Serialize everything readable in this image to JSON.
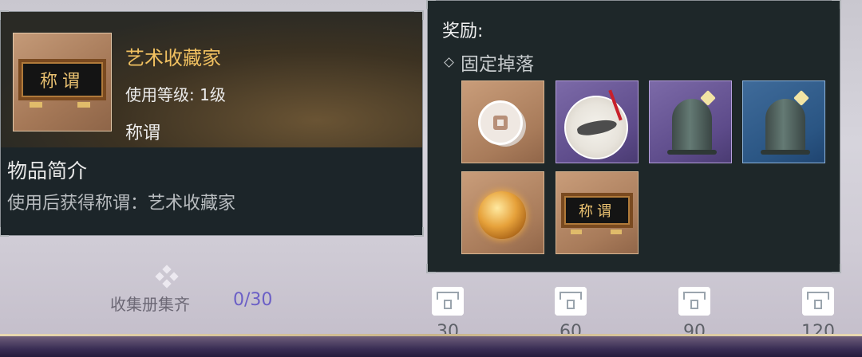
{
  "item": {
    "name": "艺术收藏家",
    "level": "使用等级: 1级",
    "type": "称谓",
    "icon_text": "称谓",
    "desc_title": "物品简介",
    "desc_text": "使用后获得称谓：艺术收藏家",
    "icon": "title-plaque-icon"
  },
  "reward": {
    "title": "奖励:",
    "drop_label": "固定掉落",
    "items": [
      {
        "icon": "coin-icon",
        "rarity": "brown"
      },
      {
        "icon": "painted-fan-icon",
        "rarity": "purple"
      },
      {
        "icon": "bronze-bell-icon",
        "rarity": "purple"
      },
      {
        "icon": "bronze-bell-icon",
        "rarity": "blue"
      },
      {
        "icon": "golden-orb-icon",
        "rarity": "brown"
      },
      {
        "icon": "title-plaque-icon",
        "rarity": "brown",
        "text": "称谓"
      }
    ]
  },
  "collection": {
    "label": "收集册集齐",
    "value": "0/30",
    "milestones": [
      "30",
      "60",
      "90",
      "120"
    ],
    "accent": "#6b5fc6"
  },
  "colors": {
    "item_name": "#f0c060",
    "panel_bg": "#1c2529"
  }
}
